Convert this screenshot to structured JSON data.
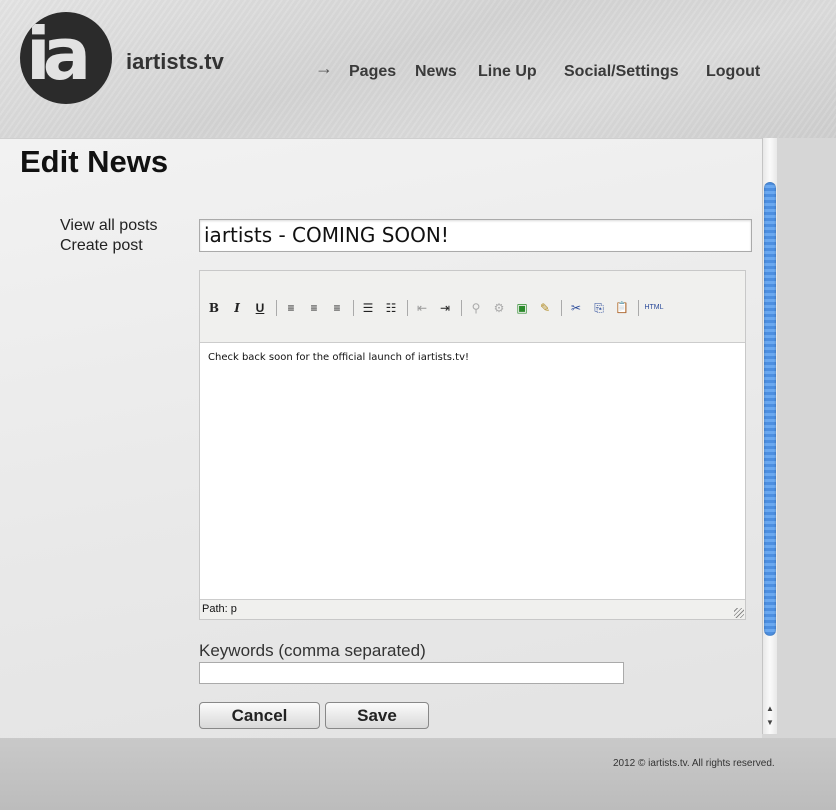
{
  "header": {
    "logo_text": "ia",
    "brand": "iartists.tv",
    "nav_arrow": "→",
    "nav": [
      {
        "label": "Pages"
      },
      {
        "label": "News"
      },
      {
        "label": "Line Up"
      },
      {
        "label": "Social/Settings"
      },
      {
        "label": "Logout"
      }
    ]
  },
  "main": {
    "title": "Edit News",
    "side_links": [
      {
        "label": "View all posts"
      },
      {
        "label": "Create post"
      }
    ],
    "post_title": "iartists - COMING SOON!",
    "editor": {
      "toolbar": {
        "bold": "B",
        "italic": "I",
        "underline": "U",
        "align_left": "≡",
        "align_center": "≡",
        "align_right": "≡",
        "bullet_list": "☰",
        "numbered_list": "☷",
        "outdent": "⇤",
        "indent": "⇥",
        "link": "⚲",
        "unlink": "⚙",
        "image": "▣",
        "cleanup": "✎",
        "cut": "✂",
        "copy": "⎘",
        "paste": "📋",
        "html": "HTML"
      },
      "body": "Check back soon for the official launch of iartists.tv!",
      "path": "Path: p"
    },
    "keywords_label": "Keywords (comma separated)",
    "keywords_value": "",
    "cancel_label": "Cancel",
    "save_label": "Save"
  },
  "scrollbar": {
    "up": "▲",
    "down": "▼"
  },
  "footer": {
    "copyright": "2012 © iartists.tv. All rights reserved."
  }
}
